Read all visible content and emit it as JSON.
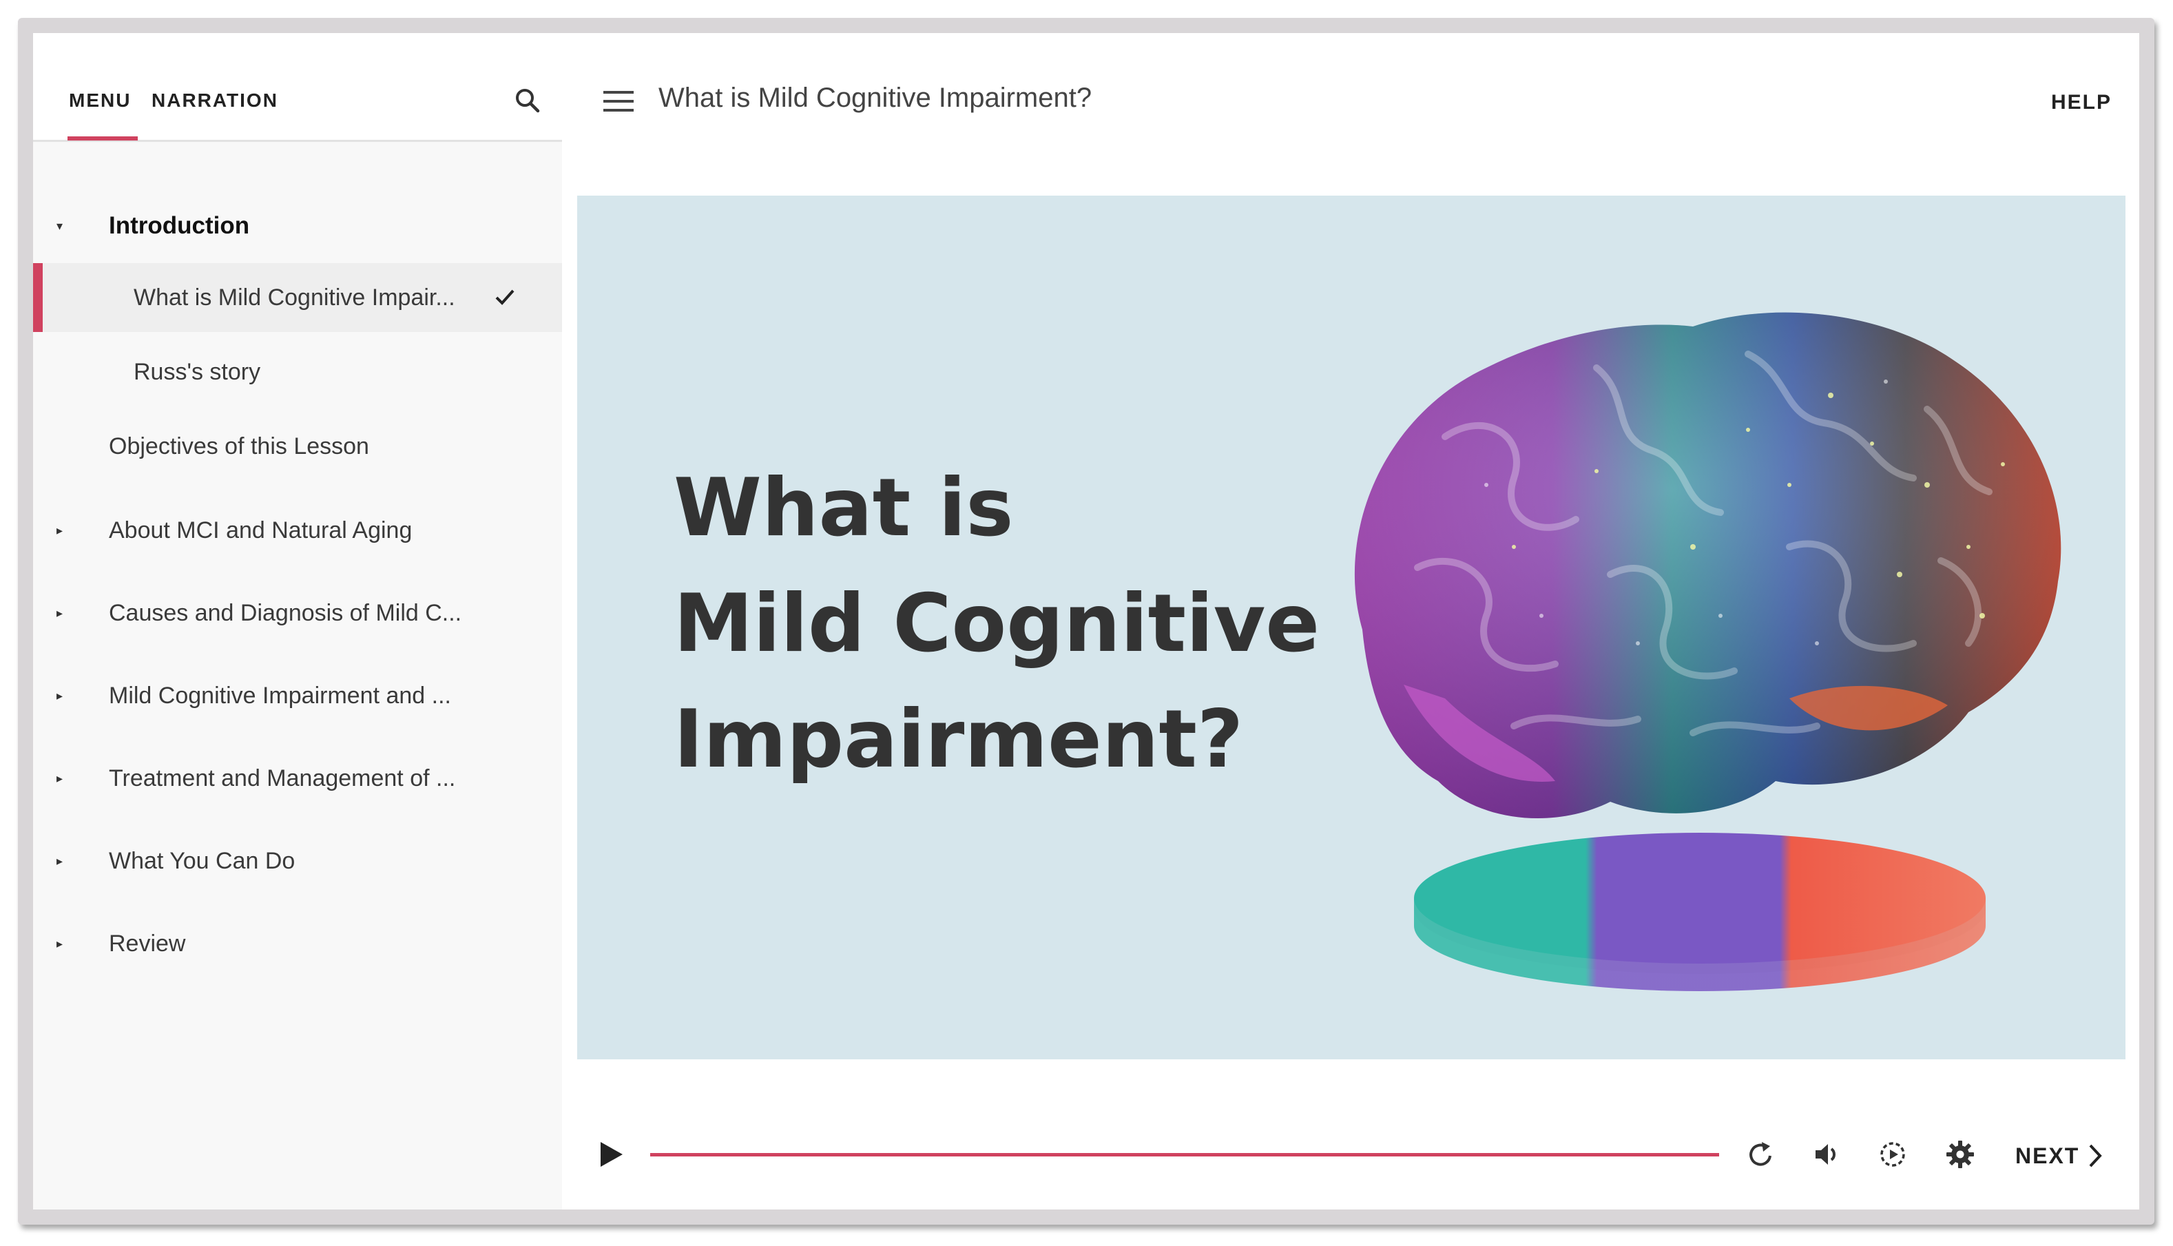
{
  "sidebar": {
    "tabs": [
      {
        "label": "MENU",
        "active": true
      },
      {
        "label": "NARRATION",
        "active": false
      }
    ],
    "search_icon": "search-icon",
    "items": [
      {
        "label": "Introduction",
        "expanded": true
      },
      {
        "label": "What is Mild Cognitive Impair...",
        "completed": true,
        "active": true
      },
      {
        "label": "Russ's story"
      },
      {
        "label": "Objectives of this Lesson"
      },
      {
        "label": "About MCI and Natural Aging",
        "expanded": false
      },
      {
        "label": "Causes and Diagnosis of Mild C...",
        "expanded": false
      },
      {
        "label": "Mild Cognitive Impairment and ...",
        "expanded": false
      },
      {
        "label": "Treatment and Management of ...",
        "expanded": false
      },
      {
        "label": "What You Can Do",
        "expanded": false
      },
      {
        "label": "Review",
        "expanded": false
      }
    ]
  },
  "header": {
    "menu_icon": "hamburger-icon",
    "title": "What is Mild Cognitive Impairment?",
    "help_label": "HELP"
  },
  "slide": {
    "heading_lines": [
      "What is",
      "Mild Cognitive",
      "Impairment?"
    ],
    "background_color": "#d6e6ec",
    "image": "brain-illustration"
  },
  "player": {
    "progress": 1.0,
    "accent_color": "#d0425f",
    "icons": [
      "play-icon",
      "replay-icon",
      "volume-icon",
      "playback-speed-icon",
      "gear-icon"
    ],
    "next_label": "NEXT"
  }
}
